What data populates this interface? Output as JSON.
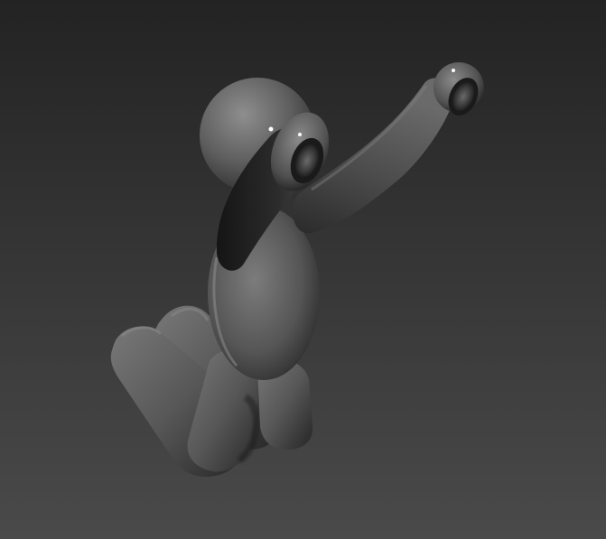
{
  "scene": {
    "subject": "3d-figure-icon",
    "background_top": "#232323",
    "background_bottom": "#4a4a4a",
    "body_light": "#8c8c8c",
    "body_mid": "#5c5c5c",
    "body_dark": "#1c1c1c",
    "specular": "#ffffff"
  }
}
